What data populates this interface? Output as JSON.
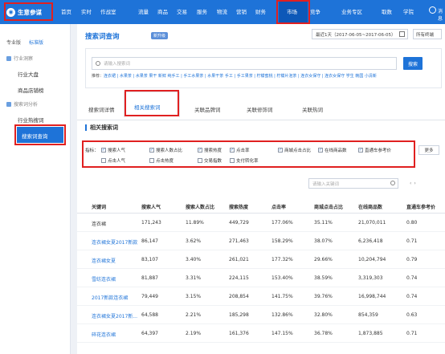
{
  "topnav": {
    "logo_text": "生意参谋",
    "items": [
      {
        "label": "首页"
      },
      {
        "label": "实时"
      },
      {
        "label": "作战室"
      },
      {
        "label": "流量"
      },
      {
        "label": "商品"
      },
      {
        "label": "交易"
      },
      {
        "label": "服务"
      },
      {
        "label": "物流"
      },
      {
        "label": "营销"
      },
      {
        "label": "财务"
      },
      {
        "label": "市场"
      },
      {
        "label": "竞争"
      },
      {
        "label": "业务专区"
      },
      {
        "label": "取数"
      },
      {
        "label": "学院"
      }
    ],
    "user_text": "消息"
  },
  "sidebar": {
    "tab_pro": "专业版",
    "tab_std": "标准版",
    "section1": "行业洞察",
    "items1": [
      "行业大盘",
      "商品店铺榜"
    ],
    "section2": "搜索词分析",
    "items2": [
      "行业热搜词",
      "搜索词查询"
    ]
  },
  "header": {
    "title": "搜索词查询",
    "badge": "新升级",
    "date_range": "最近1天（2017-06-05~2017-06-05）",
    "terminal": "所有终端"
  },
  "search": {
    "placeholder": "请输入搜索词",
    "button": "搜索",
    "recommend_label": "推荐：",
    "recommend_links": "连衣裙 | 水果茶 | 水果茶 果干 新鲜 纯手工 | 手工水果茶 | 水果干茶 手工 | 手工果茶 | 柠檬蜜桃 | 柠檬片泡茶 | 连衣女保守 | 连衣女保守 学生 韩国 小清新"
  },
  "tabs": [
    "搜索词详情",
    "相关搜索词",
    "关联品牌词",
    "关联修饰词",
    "关联热词"
  ],
  "section_title": "相关搜索词",
  "metrics": {
    "label": "指标：",
    "items": [
      {
        "label": "搜索人气",
        "checked": true
      },
      {
        "label": "搜索人数占比",
        "checked": true
      },
      {
        "label": "搜索热度",
        "checked": true
      },
      {
        "label": "点击率",
        "checked": true
      },
      {
        "label": "商城点击占比",
        "checked": true
      },
      {
        "label": "在线商品数",
        "checked": true
      },
      {
        "label": "直通车参考价",
        "checked": true
      },
      {
        "label": "点击人气",
        "checked": false
      },
      {
        "label": "点击热度",
        "checked": false
      },
      {
        "label": "交易指数",
        "checked": false
      },
      {
        "label": "支付转化率",
        "checked": false
      }
    ],
    "more": "更多"
  },
  "filter": {
    "placeholder": "请输入关键词"
  },
  "pager": {
    "prev": "‹",
    "next": "›"
  },
  "table": {
    "headers": [
      "关键词",
      "搜索人气",
      "搜索人数占比",
      "搜索热度",
      "点击率",
      "商城点击占比",
      "在线商品数",
      "直通车参考价"
    ],
    "rows": [
      [
        "连衣裙",
        "171,243",
        "11.89%",
        "449,729",
        "177.06%",
        "35.11%",
        "21,070,011",
        "0.80"
      ],
      [
        "连衣裙女夏2017新款",
        "86,147",
        "3.62%",
        "271,463",
        "158.29%",
        "38.07%",
        "6,236,418",
        "0.71"
      ],
      [
        "连衣裙女夏",
        "83,107",
        "3.40%",
        "261,021",
        "177.32%",
        "29.66%",
        "10,204,794",
        "0.79"
      ],
      [
        "雪纺连衣裙",
        "81,887",
        "3.31%",
        "224,115",
        "153.40%",
        "38.59%",
        "3,319,303",
        "0.74"
      ],
      [
        "2017新款连衣裙",
        "79,449",
        "3.15%",
        "208,854",
        "141.75%",
        "39.76%",
        "16,998,744",
        "0.74"
      ],
      [
        "连衣裙女夏2017新...",
        "64,588",
        "2.21%",
        "185,298",
        "132.86%",
        "32.80%",
        "854,359",
        "0.63"
      ],
      [
        "碎花连衣裙",
        "64,397",
        "2.19%",
        "161,376",
        "147.15%",
        "36.78%",
        "1,873,885",
        "0.71"
      ],
      [
        "",
        "",
        "",
        "",
        "",
        "",
        "",
        ""
      ]
    ]
  }
}
